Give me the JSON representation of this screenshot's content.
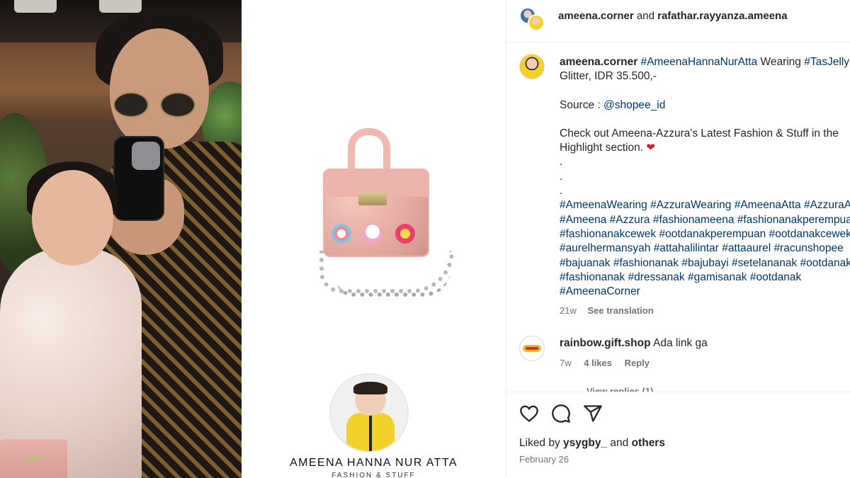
{
  "header": {
    "user1": "ameena.corner",
    "connector": "and",
    "user2": "rafathar.rayyanza.ameena"
  },
  "caption": {
    "username": "ameena.corner",
    "line1_tag1": "#AmeenaHannaNurAtta",
    "line1_word": "Wearing",
    "line1_tag2": "#TasJelly",
    "line2": "Glitter, IDR 35.500,-",
    "source_label": "Source :",
    "source_handle": "@shopee_id",
    "checkout_line1": "Check out Ameena-Azzura's Latest Fashion & Stuff in the",
    "checkout_line2": "Highlight section.",
    "dots": [
      ".",
      ".",
      "."
    ],
    "hashtag_lines": [
      "#AmeenaWearing #AzzuraWearing #AmeenaAtta #AzzuraAtta",
      "#Ameena #Azzura #fashionameena #fashionanakperempuan",
      "#fashionanakcewek #ootdanakperempuan #ootdanakcewek",
      "#aurelhermansyah #attahalilintar #attaaurel #racunshopee",
      "#bajuanak #fashionanak #bajubayi #setelananak #ootdanak",
      "#fashionanak #dressanak #gamisanak #ootdanak",
      "#AmeenaCorner"
    ],
    "time": "21w",
    "see_translation": "See translation"
  },
  "comment": {
    "username": "rainbow.gift.shop",
    "text": "Ada link ga",
    "time": "7w",
    "likes": "4 likes",
    "reply": "Reply",
    "view_replies": "View replies (1)"
  },
  "footer": {
    "liked_by_prefix": "Liked by",
    "liked_by_user": "ysygby_",
    "liked_by_and": "and",
    "liked_by_others": "others",
    "date": "February 26"
  },
  "product_image": {
    "shop_name": "AMEENA HANNA NUR ATTA",
    "shop_tagline": "FASHION & STUFF"
  },
  "icons": {
    "like": "heart-icon",
    "comment": "comment-icon",
    "share": "share-icon"
  },
  "colors": {
    "hashtag": "#00376b",
    "muted": "#737373",
    "heart_emoji": "#d0212c"
  }
}
